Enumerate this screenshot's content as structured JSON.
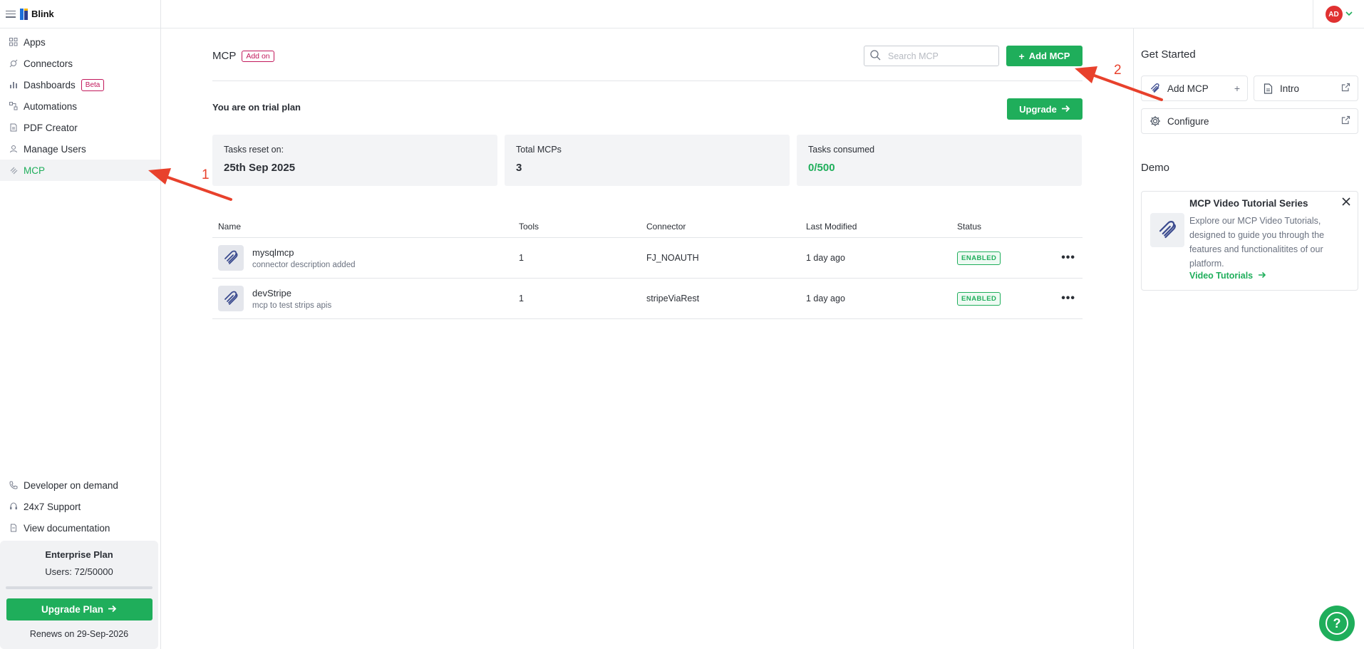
{
  "brand": {
    "name": "Blink"
  },
  "sidebar": {
    "items": [
      {
        "label": "Apps",
        "icon": "apps-icon"
      },
      {
        "label": "Connectors",
        "icon": "plug-icon"
      },
      {
        "label": "Dashboards",
        "icon": "bar-chart-icon",
        "badge": "Beta"
      },
      {
        "label": "Automations",
        "icon": "flow-icon"
      },
      {
        "label": "PDF Creator",
        "icon": "pdf-icon"
      },
      {
        "label": "Manage Users",
        "icon": "user-icon"
      },
      {
        "label": "MCP",
        "icon": "mcp-icon",
        "active": true
      }
    ],
    "bottom_links": [
      {
        "label": "Developer on demand",
        "icon": "phone-icon"
      },
      {
        "label": "24x7 Support",
        "icon": "headset-icon"
      },
      {
        "label": "View documentation",
        "icon": "document-icon"
      }
    ],
    "plan": {
      "title": "Enterprise Plan",
      "users": "Users: 72/50000",
      "button": "Upgrade Plan",
      "renews": "Renews on 29-Sep-2026"
    }
  },
  "topbar": {
    "avatar_initials": "AD"
  },
  "main": {
    "title": "MCP",
    "addon_badge": "Add on",
    "search_placeholder": "Search MCP",
    "add_button": "Add MCP",
    "trial_text": "You are on trial plan",
    "upgrade_button": "Upgrade",
    "cards": [
      {
        "label": "Tasks reset on:",
        "value": "25th Sep 2025"
      },
      {
        "label": "Total MCPs",
        "value": "3"
      },
      {
        "label": "Tasks consumed",
        "value": "0/500"
      }
    ],
    "table": {
      "columns": [
        "Name",
        "Tools",
        "Connector",
        "Last Modified",
        "Status"
      ],
      "rows": [
        {
          "name": "mysqlmcp",
          "description": "connector description added",
          "tools": "1",
          "connector": "FJ_NOAUTH",
          "modified": "1 day ago",
          "status": "ENABLED"
        },
        {
          "name": "devStripe",
          "description": "mcp to test strips apis",
          "tools": "1",
          "connector": "stripeViaRest",
          "modified": "1 day ago",
          "status": "ENABLED"
        }
      ]
    }
  },
  "right_panel": {
    "get_started_title": "Get Started",
    "buttons": [
      {
        "label": "Add MCP",
        "icon": "mcp-icon",
        "trail": "plus-icon"
      },
      {
        "label": "Intro",
        "icon": "document-icon",
        "trail": "external-link-icon"
      },
      {
        "label": "Configure",
        "icon": "gear-icon",
        "trail": "external-link-icon"
      }
    ],
    "demo_title": "Demo",
    "demo_card": {
      "title": "MCP Video Tutorial Series",
      "text": "Explore our MCP Video Tutorials, designed to guide you through the features and functionalitites of our platform.",
      "link": "Video Tutorials"
    }
  },
  "annotations": {
    "labels": [
      "1",
      "2"
    ],
    "color": "#e8412c"
  },
  "colors": {
    "accent": "#1fae5b",
    "addon": "#c2185b"
  }
}
